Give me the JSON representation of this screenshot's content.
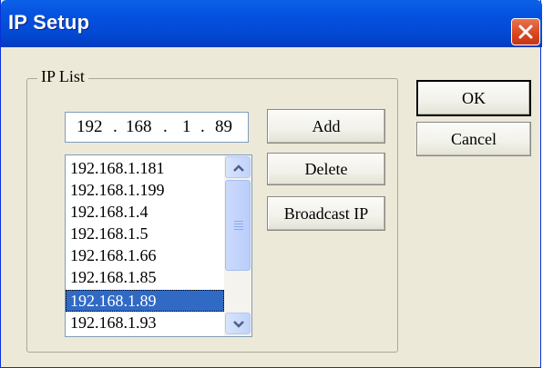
{
  "window": {
    "title": "IP Setup"
  },
  "group": {
    "label": "IP List"
  },
  "ip_input": {
    "octets": [
      "192",
      "168",
      "1",
      "89"
    ]
  },
  "list": {
    "items": [
      "192.168.1.181",
      "192.168.1.199",
      "192.168.1.4",
      "192.168.1.5",
      "192.168.1.66",
      "192.168.1.85",
      "192.168.1.89",
      "192.168.1.93"
    ],
    "selected": "192.168.1.89"
  },
  "buttons": {
    "add": "Add",
    "delete": "Delete",
    "broadcast": "Broadcast IP",
    "ok": "OK",
    "cancel": "Cancel"
  },
  "icons": {
    "close": "close-icon",
    "scroll_up": "chevron-up-icon",
    "scroll_down": "chevron-down-icon"
  },
  "colors": {
    "titlebar": "#0552e0",
    "selection": "#316ac5",
    "close": "#d8451d",
    "face": "#ece9d8"
  }
}
